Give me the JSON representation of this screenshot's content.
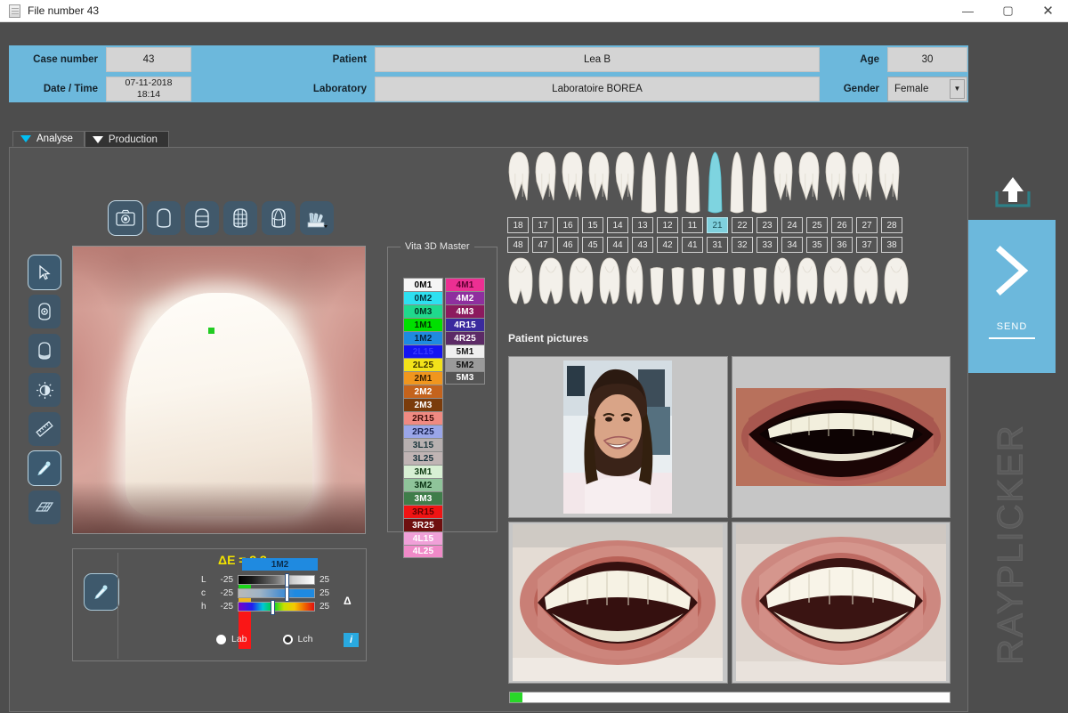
{
  "window": {
    "title": "File number 43",
    "minimize": "—",
    "maximize": "▢",
    "close": "✕"
  },
  "patient_info": {
    "case_number_label": "Case number",
    "case_number_value": "43",
    "date_time_label": "Date / Time",
    "date_value": "07-11-2018",
    "time_value": "18:14",
    "patient_label": "Patient",
    "patient_value": "Lea B",
    "laboratory_label": "Laboratory",
    "laboratory_value": "Laboratoire BOREA",
    "age_label": "Age",
    "age_value": "30",
    "gender_label": "Gender",
    "gender_value": "Female"
  },
  "tabs": [
    {
      "label": "Analyse",
      "active": true
    },
    {
      "label": "Production",
      "active": false
    }
  ],
  "left_toolbar": [
    {
      "name": "cursor-select-tool",
      "selected": true
    },
    {
      "name": "tooth-point-tool",
      "selected": false
    },
    {
      "name": "tooth-shape-tool",
      "selected": false
    },
    {
      "name": "brightness-contrast-tool",
      "selected": false
    },
    {
      "name": "measure-ruler-tool",
      "selected": false
    },
    {
      "name": "eyedropper-tool",
      "selected": true
    },
    {
      "name": "perspective-grid-tool",
      "selected": false
    }
  ],
  "top_toolbar": [
    {
      "name": "camera-view",
      "selected": true
    },
    {
      "name": "tooth-plain-view",
      "selected": false
    },
    {
      "name": "tooth-zones-view",
      "selected": false
    },
    {
      "name": "tooth-grid-view",
      "selected": false
    },
    {
      "name": "tooth-3d-view",
      "selected": false
    },
    {
      "name": "shade-guide-fan",
      "selected": false
    }
  ],
  "vita": {
    "title": "Vita 3D Master",
    "column1": [
      {
        "label": "0M1",
        "bg": "#f5f5f5",
        "fg": "#000000"
      },
      {
        "label": "0M2",
        "bg": "#2ee0f0",
        "fg": "#00303a"
      },
      {
        "label": "0M3",
        "bg": "#1fd98c",
        "fg": "#003322"
      },
      {
        "label": "1M1",
        "bg": "#00e000",
        "fg": "#003300"
      },
      {
        "label": "1M2",
        "bg": "#1f8ae0",
        "fg": "#04243d"
      },
      {
        "label": "2L15",
        "bg": "#1414f0",
        "fg": "#3a3aff"
      },
      {
        "label": "2L25",
        "bg": "#f2e21a",
        "fg": "#3a3200"
      },
      {
        "label": "2M1",
        "bg": "#f0961e",
        "fg": "#3d2200"
      },
      {
        "label": "2M2",
        "bg": "#c4631c",
        "fg": "#ffffff"
      },
      {
        "label": "2M3",
        "bg": "#7a3c0c",
        "fg": "#ffffff"
      },
      {
        "label": "2R15",
        "bg": "#f08a82",
        "fg": "#3d0c08"
      },
      {
        "label": "2R25",
        "bg": "#9aa6e8",
        "fg": "#16204f"
      },
      {
        "label": "3L15",
        "bg": "#b7b0b0",
        "fg": "#18333a"
      },
      {
        "label": "3L25",
        "bg": "#c0b4b4",
        "fg": "#14303a"
      },
      {
        "label": "3M1",
        "bg": "#d8f0d4",
        "fg": "#0e3a12"
      },
      {
        "label": "3M2",
        "bg": "#8fc49a",
        "fg": "#0c3314"
      },
      {
        "label": "3M3",
        "bg": "#3f7d4a",
        "fg": "#ffffff"
      },
      {
        "label": "3R15",
        "bg": "#f01414",
        "fg": "#5c0000"
      },
      {
        "label": "3R25",
        "bg": "#6e0f0f",
        "fg": "#ffffff"
      },
      {
        "label": "4L15",
        "bg": "#f0a0d8",
        "fg": "#ffffff"
      },
      {
        "label": "4L25",
        "bg": "#f08ac8",
        "fg": "#ffffff"
      }
    ],
    "column2": [
      {
        "label": "4M1",
        "bg": "#ec2f92",
        "fg": "#5c0030"
      },
      {
        "label": "4M2",
        "bg": "#8e2f9e",
        "fg": "#ffffff"
      },
      {
        "label": "4M3",
        "bg": "#8c1a5e",
        "fg": "#ffffff"
      },
      {
        "label": "4R15",
        "bg": "#3a2a9e",
        "fg": "#ffffff"
      },
      {
        "label": "4R25",
        "bg": "#5c2a66",
        "fg": "#ffffff"
      },
      {
        "label": "5M1",
        "bg": "#efefef",
        "fg": "#1a1a1a"
      },
      {
        "label": "5M2",
        "bg": "#9a9a9a",
        "fg": "#111111"
      },
      {
        "label": "5M3",
        "bg": "#555555",
        "fg": "#ffffff"
      }
    ]
  },
  "analysis": {
    "delta_e_label": "ΔE = 3.3",
    "selected_shade": "1M2",
    "selected_shade_bg": "#1f8ae0",
    "delta_glyph": "Δ",
    "info_label": "i",
    "sliders": [
      {
        "label": "L",
        "min": "-25",
        "max": "25",
        "knob_pct": 62
      },
      {
        "label": "c",
        "min": "-25",
        "max": "25",
        "knob_pct": 62
      },
      {
        "label": "h",
        "min": "-25",
        "max": "25",
        "knob_pct": 44
      }
    ],
    "color_space_options": [
      {
        "label": "Lab",
        "selected": false
      },
      {
        "label": "Lch",
        "selected": true
      }
    ]
  },
  "teeth_chart": {
    "upper_numbers": [
      "18",
      "17",
      "16",
      "15",
      "14",
      "13",
      "12",
      "11",
      "21",
      "22",
      "23",
      "24",
      "25",
      "26",
      "27",
      "28"
    ],
    "lower_numbers": [
      "48",
      "47",
      "46",
      "45",
      "44",
      "43",
      "42",
      "41",
      "31",
      "32",
      "33",
      "34",
      "35",
      "36",
      "37",
      "38"
    ],
    "selected_tooth": "21",
    "selected_color": "#7fd0dd"
  },
  "patient_pictures": {
    "header": "Patient pictures",
    "delete_icon": "delete-image-icon",
    "mobile_icon": "mobile-device-icon",
    "items": [
      "portrait-photo",
      "smile-closeup-photo",
      "retractor-frontal-photo",
      "retractor-frontal-photo-2"
    ]
  },
  "send_panel": {
    "upload_icon": "upload-icon",
    "chevron": "›",
    "label": "SEND"
  },
  "watermark": {
    "text": "RAYPLICKER"
  }
}
